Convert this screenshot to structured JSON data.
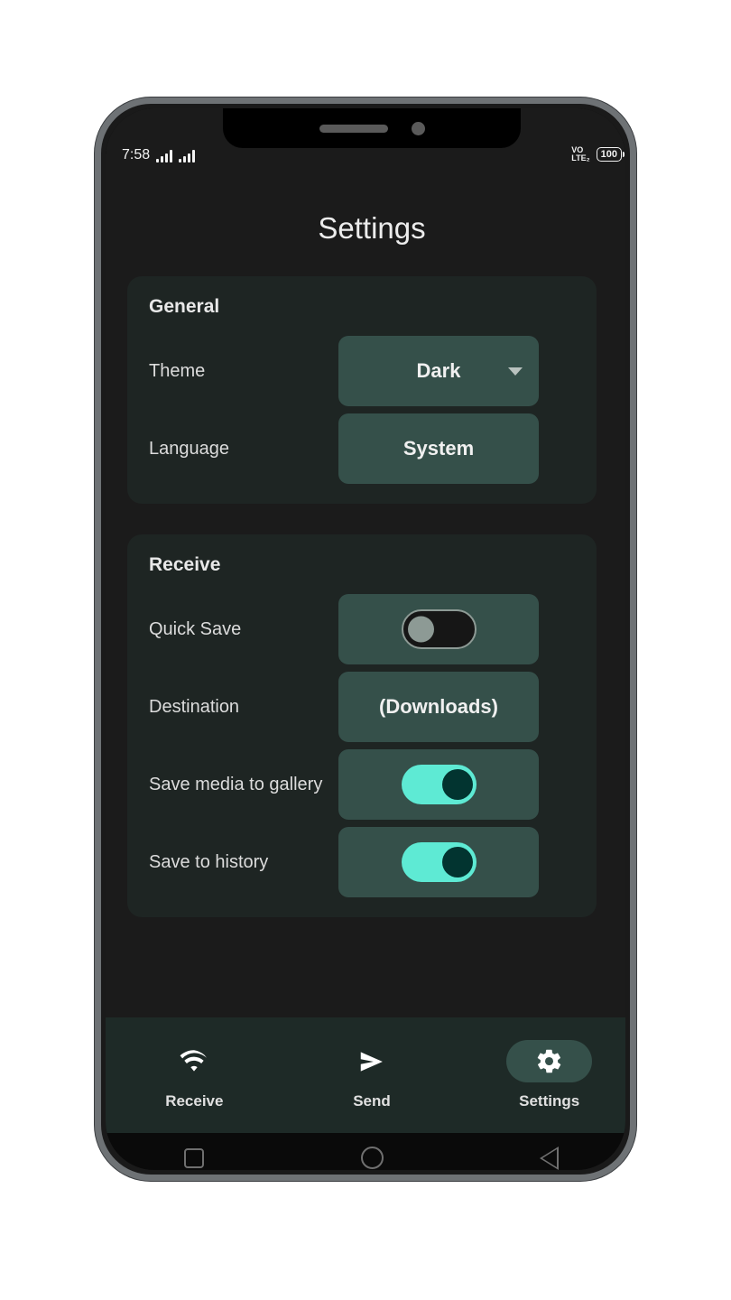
{
  "status_bar": {
    "time": "7:58",
    "signal_icon_1": "signal-bars-icon",
    "signal_icon_2": "signal-bars-icon",
    "volte_line1": "VO",
    "volte_line2": "LTE₂",
    "battery_level": "100"
  },
  "header": {
    "title": "Settings"
  },
  "sections": [
    {
      "title": "General",
      "rows": [
        {
          "label": "Theme",
          "control_type": "dropdown",
          "value": "Dark",
          "has_chevron": true
        },
        {
          "label": "Language",
          "control_type": "button",
          "value": "System",
          "has_chevron": false
        }
      ]
    },
    {
      "title": "Receive",
      "rows": [
        {
          "label": "Quick Save",
          "control_type": "toggle",
          "value": "off"
        },
        {
          "label": "Destination",
          "control_type": "button",
          "value": "(Downloads)",
          "has_chevron": false
        },
        {
          "label": "Save media to gallery",
          "control_type": "toggle",
          "value": "on"
        },
        {
          "label": "Save to history",
          "control_type": "toggle",
          "value": "on"
        }
      ]
    }
  ],
  "bottom_nav": {
    "items": [
      {
        "label": "Receive",
        "icon": "wifi-icon",
        "active": false
      },
      {
        "label": "Send",
        "icon": "paper-plane-icon",
        "active": false
      },
      {
        "label": "Settings",
        "icon": "gear-icon",
        "active": true
      }
    ]
  },
  "system_nav": {
    "recents": "square-recents-icon",
    "home": "circle-home-icon",
    "back": "triangle-back-icon"
  },
  "colors": {
    "screen_bg": "#1b1b1b",
    "card_bg": "#1e2523",
    "control_bg": "#35504a",
    "toggle_on": "#5eead4",
    "toggle_knob_on": "#023430",
    "nav_bg": "#1e2a27"
  }
}
